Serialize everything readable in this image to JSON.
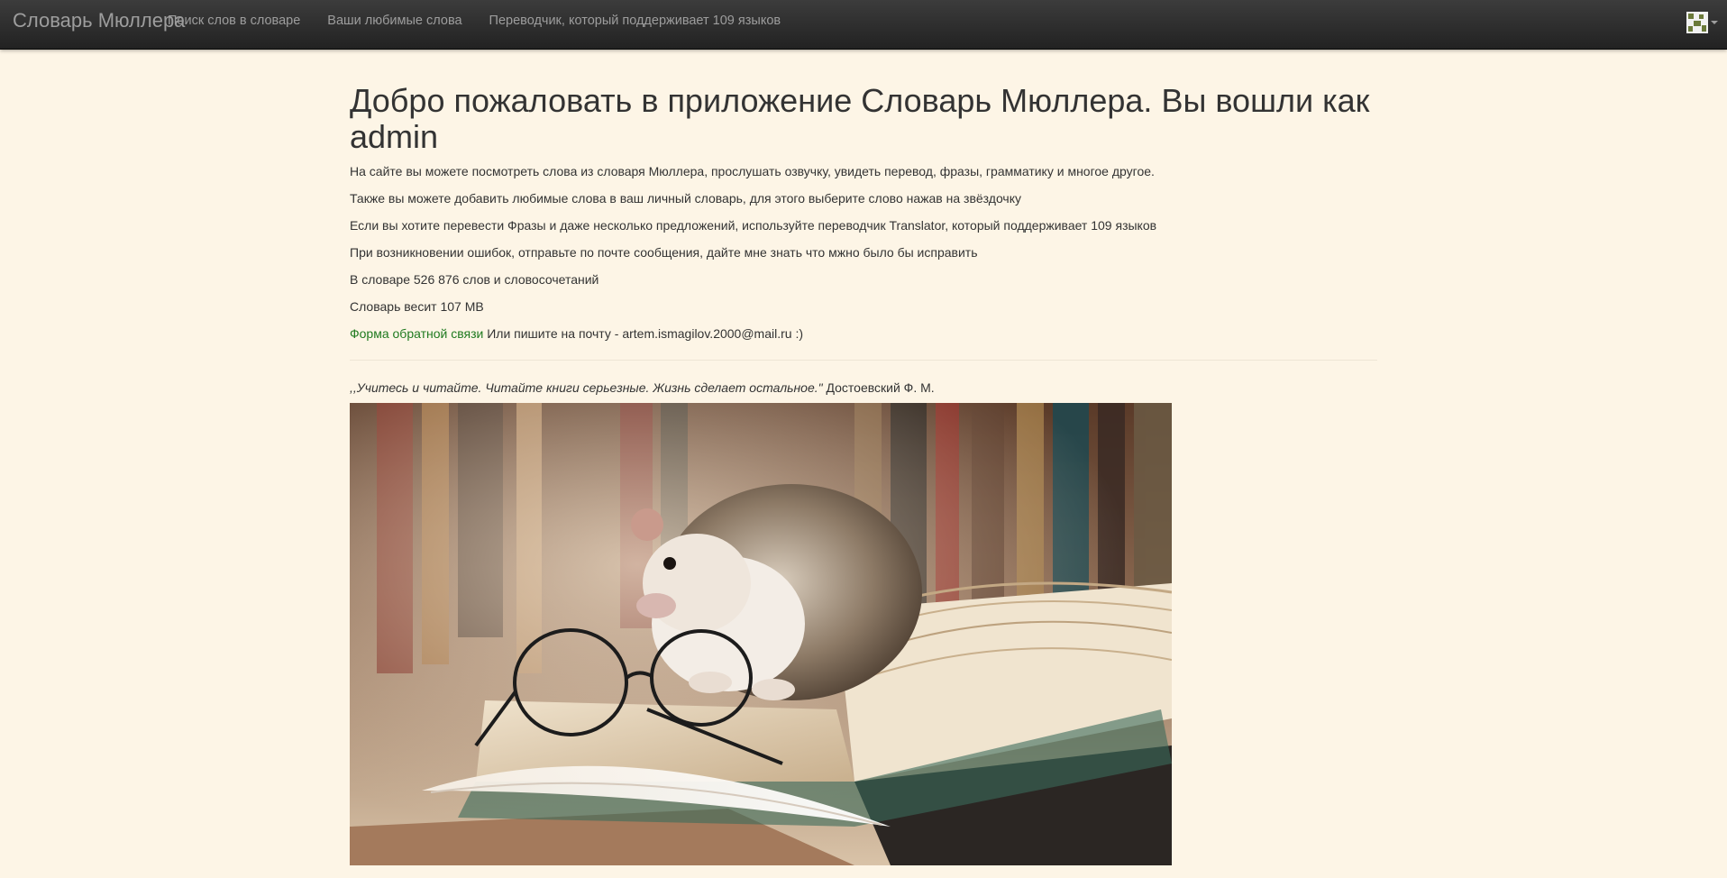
{
  "navbar": {
    "brand": "Словарь Мюллера",
    "links": [
      {
        "label": "Поиск слов в словаре"
      },
      {
        "label": "Ваши любимые слова"
      },
      {
        "label": "Переводчик, который поддерживает 109 языков"
      }
    ],
    "avatar_icon": "user-avatar-icon",
    "dropdown_icon": "caret-down-icon"
  },
  "main": {
    "title": "Добро пожаловать в приложение Словарь Мюллера. Вы вошли как admin",
    "paragraphs": [
      "На сайте вы можете посмотреть слова из словаря Мюллера, прослушать озвучку, увидеть перевод, фразы, грамматику и многое другое.",
      "Также вы можете добавить любимые слова в ваш личный словарь, для этого выберите слово нажав на звёздочку",
      "Если вы хотите перевести Фразы и даже несколько предложений, используйте переводчик Translator, который поддерживает 109 языков",
      "При возникновении ошибок, отправьте по почте сообщения, дайте мне знать что мжно было бы исправить",
      "В словаре 526 876 слов и словосочетаний",
      "Словарь весит 107 MB"
    ],
    "feedback_link": "Форма обратной связи",
    "feedback_text": " Или пишите на почту - artem.ismagilov.2000@mail.ru :)",
    "quote_text": ",,Учитесь и читайте. Читайте книги серьезные. Жизнь сделает остальное.\"",
    "quote_author": " Достоевский Ф. М.",
    "image_subject": "hedgehog-on-book-with-glasses"
  },
  "colors": {
    "background": "#fdf5e6",
    "navbar": "#222222",
    "nav_text": "#9d9d9d",
    "link": "#1f7a1f",
    "text": "#333333"
  }
}
